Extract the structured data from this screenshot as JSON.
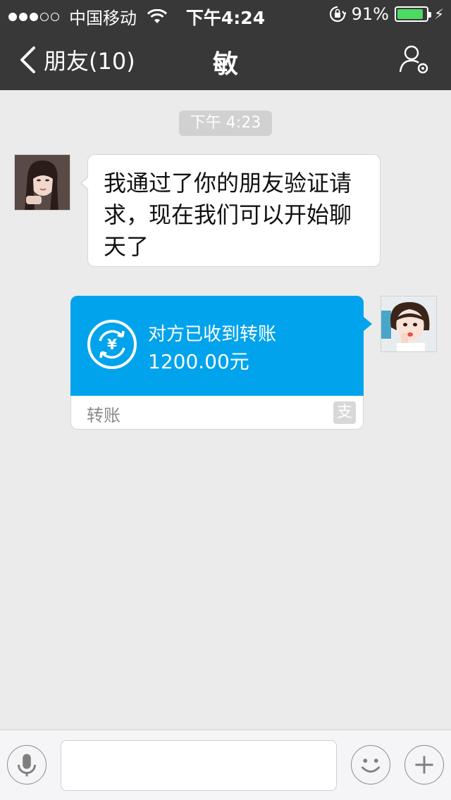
{
  "status_bar": {
    "carrier": "中国移动",
    "time": "下午4:24",
    "battery": "91%",
    "battery_level": 0.91,
    "signal_bars": 3
  },
  "nav": {
    "back_label": "朋友(10)",
    "title": "敏"
  },
  "chat": {
    "timestamp": "下午 4:23",
    "messages": [
      {
        "side": "left",
        "text": "我通过了你的朋友验证请求，现在我们可以开始聊天了"
      }
    ],
    "transfer": {
      "status": "对方已收到转账",
      "amount": "1200.00元",
      "label": "转账",
      "icon": "alipay-icon"
    }
  },
  "colors": {
    "nav_bg": "#383838",
    "chat_bg": "#ebebeb",
    "transfer_blue": "#00a3ec",
    "battery_green": "#4cd964"
  }
}
